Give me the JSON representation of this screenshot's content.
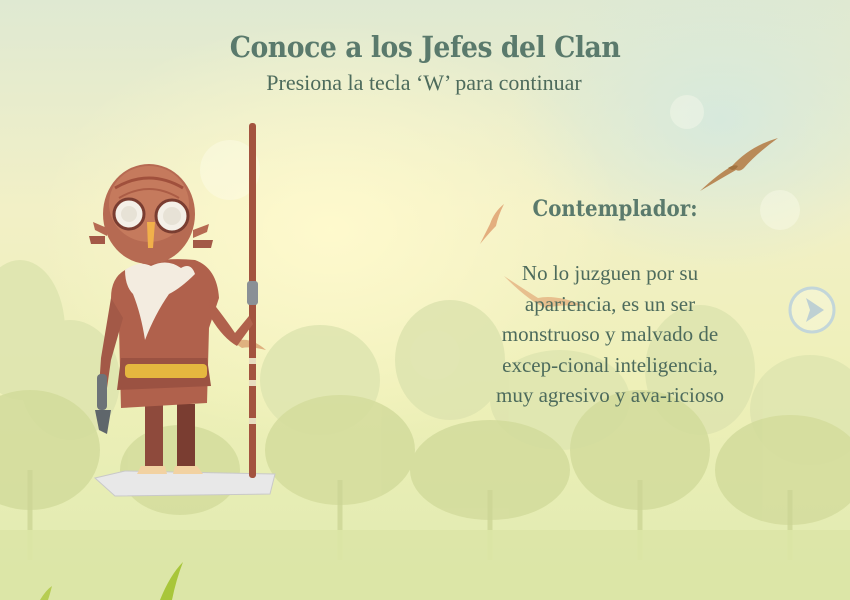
{
  "screen": {
    "title": "Conoce a los Jefes del Clan",
    "subtitle": "Presiona la tecla ‘W’ para continuar"
  },
  "chief": {
    "name": "Contemplador:",
    "description": "No lo juzguen por su apariencia, es un ser monstruoso y malvado de excep-cional inteligencia, muy agresivo y ava-ricioso"
  },
  "icons": {
    "next": "next-arrow-icon",
    "character": "contemplador-character",
    "birds": "bird-icon"
  },
  "colors": {
    "title_text": "#5a7a6c",
    "body_text": "#4d6b5c",
    "sky_light": "#f2f0c6",
    "tree_silhouette": "#d7dfa2"
  }
}
